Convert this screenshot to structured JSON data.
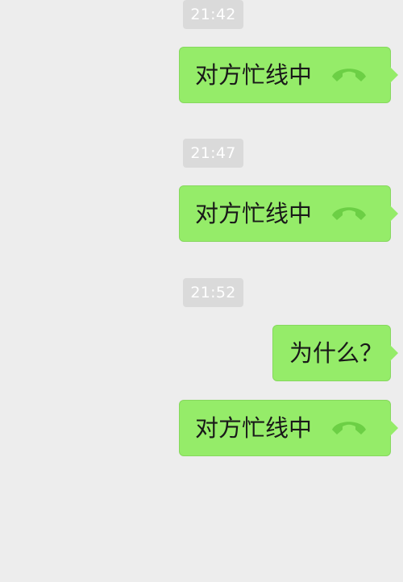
{
  "conversation": [
    {
      "time": "21:42",
      "message": "对方忙线中",
      "icon": "phone-hangup-icon"
    },
    {
      "time": "21:47",
      "message": "对方忙线中",
      "icon": "phone-hangup-icon"
    },
    {
      "time": "21:52",
      "message": "为什么？"
    },
    {
      "message": "对方忙线中",
      "icon": "phone-hangup-icon"
    }
  ],
  "colors": {
    "background": "#ededed",
    "bubble": "#95ec69",
    "timestamp": "#dadada",
    "icon": "#6ccf45"
  }
}
